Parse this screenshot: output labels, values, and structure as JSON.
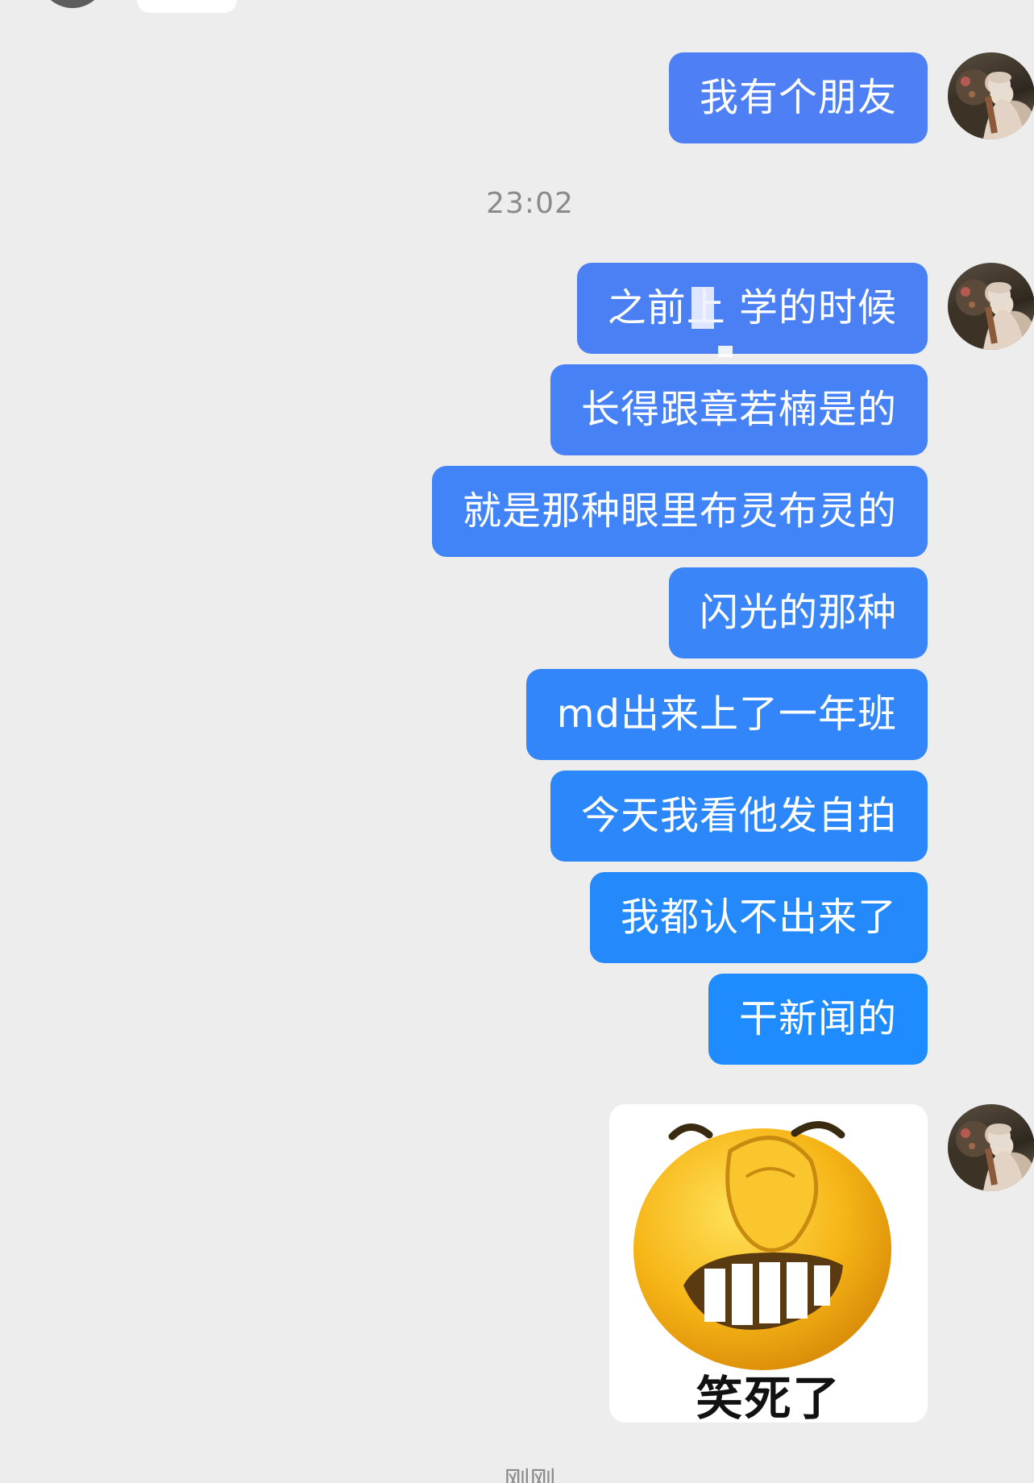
{
  "conversation": {
    "timestamps": [
      "23:02"
    ],
    "messages": [
      {
        "text": "我有个朋友"
      },
      {
        "text": "之前上  学的时候"
      },
      {
        "text": "长得跟章若楠是的"
      },
      {
        "text": "就是那种眼里布灵布灵的"
      },
      {
        "text": "闪光的那种"
      },
      {
        "text": "md出来上了一年班"
      },
      {
        "text": "今天我看他发自拍"
      },
      {
        "text": "我都认不出来了"
      },
      {
        "text": "干新闻的"
      }
    ],
    "sticker": {
      "caption": "笑死了",
      "icon": "grinning-emoji-icon"
    },
    "bottom_status": "刚刚"
  },
  "colors": {
    "background": "#ededed",
    "bubble_gradient_top": "#4a82f6",
    "bubble_gradient_bottom": "#1e8cff",
    "timestamp": "#8a8a8a"
  }
}
